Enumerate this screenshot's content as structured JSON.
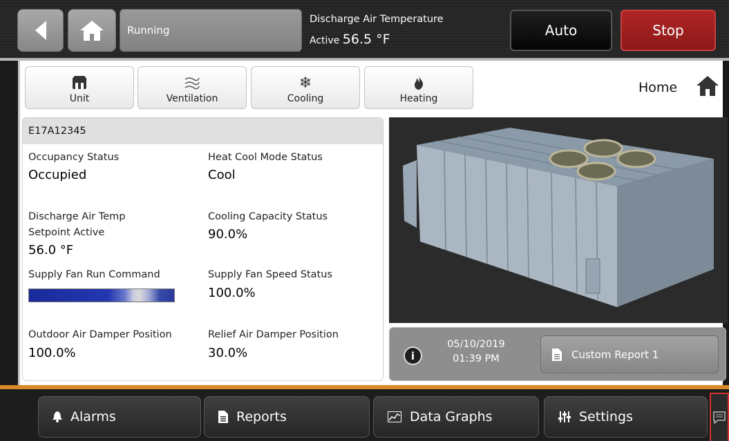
{
  "header": {
    "status": "Running",
    "discharge_title": "Discharge Air Temperature",
    "active_label": "Active",
    "active_value": "56.5 °F",
    "auto_label": "Auto",
    "stop_label": "Stop"
  },
  "nav": {
    "tabs": [
      {
        "label": "Unit",
        "icon": "unit-icon"
      },
      {
        "label": "Ventilation",
        "icon": "ventilation-icon"
      },
      {
        "label": "Cooling",
        "icon": "snowflake-icon"
      },
      {
        "label": "Heating",
        "icon": "flame-icon"
      }
    ],
    "home_label": "Home"
  },
  "info": {
    "unit_id": "E17A12345",
    "occupancy_label": "Occupancy Status",
    "occupancy_value": "Occupied",
    "heatcool_label": "Heat Cool Mode Status",
    "heatcool_value": "Cool",
    "dat_setpoint_label_1": "Discharge Air Temp",
    "dat_setpoint_label_2": "Setpoint Active",
    "dat_setpoint_value": "56.0 °F",
    "cooling_cap_label": "Cooling Capacity Status",
    "cooling_cap_value": "90.0%",
    "fan_run_label": "Supply Fan Run Command",
    "fan_speed_label": "Supply Fan Speed Status",
    "fan_speed_value": "100.0%",
    "oa_damper_label": "Outdoor Air Damper Position",
    "oa_damper_value": "100.0%",
    "relief_damper_label": "Relief Air Damper Position",
    "relief_damper_value": "30.0%"
  },
  "footer": {
    "date": "05/10/2019",
    "time": "01:39 PM",
    "report_label": "Custom Report 1"
  },
  "bottom": {
    "alarms": "Alarms",
    "reports": "Reports",
    "data_graphs": "Data Graphs",
    "settings": "Settings"
  },
  "colors": {
    "stop": "#a01e1e",
    "accent_bar": "#d9882a",
    "fan_bar": "#2338b0"
  }
}
